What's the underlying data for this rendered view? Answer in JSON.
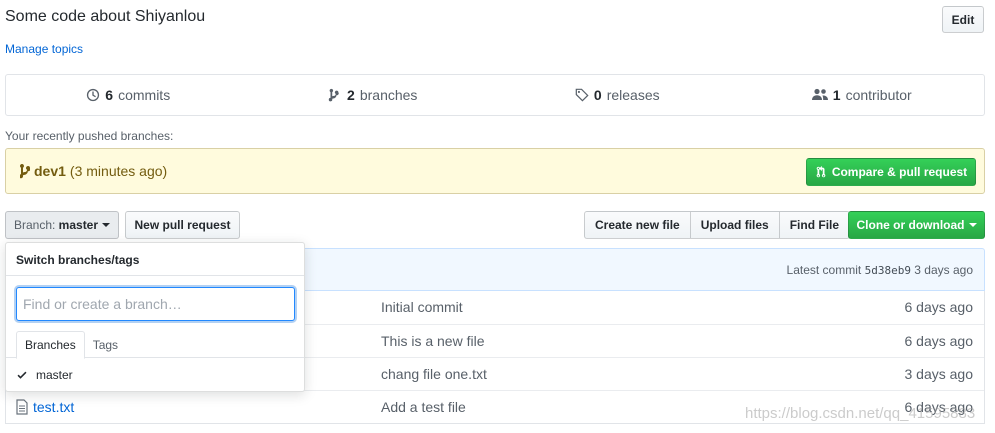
{
  "repo": {
    "description": "Some code about Shiyanlou",
    "manage_topics": "Manage topics",
    "edit_label": "Edit"
  },
  "numbers": {
    "commits_count": "6",
    "commits_label": "commits",
    "branches_count": "2",
    "branches_label": "branches",
    "releases_count": "0",
    "releases_label": "releases",
    "contributors_count": "1",
    "contributors_label": "contributor"
  },
  "recent": {
    "label": "Your recently pushed branches:",
    "branch": "dev1",
    "time": "(3 minutes ago)",
    "compare_label": "Compare & pull request"
  },
  "toolbar": {
    "branch_prefix": "Branch:",
    "branch_name": "master",
    "new_pr_label": "New pull request",
    "create_file_label": "Create new file",
    "upload_label": "Upload files",
    "find_label": "Find File",
    "clone_label": "Clone or download"
  },
  "commit": {
    "latest_label": "Latest commit",
    "sha": "5d38eb9",
    "time": "3 days ago"
  },
  "files": [
    {
      "name": "",
      "message": "Initial commit",
      "age": "6 days ago"
    },
    {
      "name": "",
      "message": "This is a new file",
      "age": "6 days ago"
    },
    {
      "name": "",
      "message": "chang file one.txt",
      "age": "3 days ago"
    },
    {
      "name": "test.txt",
      "message": "Add a test file",
      "age": "6 days ago"
    }
  ],
  "dropdown": {
    "header": "Switch branches/tags",
    "filter_placeholder": "Find or create a branch…",
    "tab_branches": "Branches",
    "tab_tags": "Tags",
    "item_master": "master"
  },
  "watermark": "https://blog.csdn.net/qq_41595883",
  "colors": {
    "link": "#0366d6",
    "green": "#28a745",
    "recent_bg": "#fffbdd",
    "commit_bar_bg": "#f1f8ff"
  }
}
